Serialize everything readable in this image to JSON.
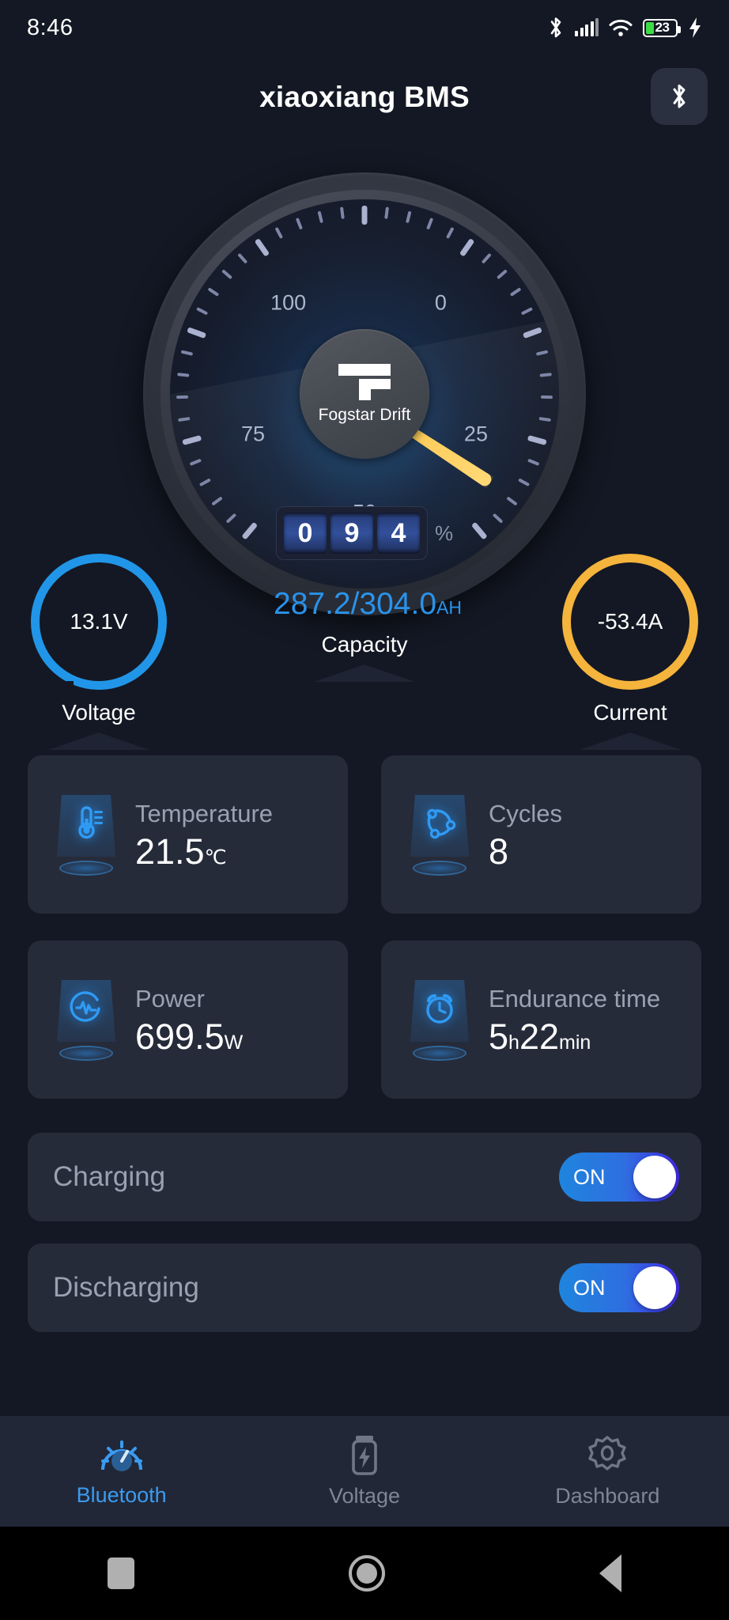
{
  "status_bar": {
    "time": "8:46",
    "bluetooth_icon": "bluetooth-icon",
    "signal_icon": "signal-bars-icon",
    "wifi_icon": "wifi-icon",
    "battery_percent": "23",
    "charging_icon": "lightning-bolt-icon"
  },
  "app_bar": {
    "title": "xiaoxiang BMS",
    "bluetooth_button_icon": "bluetooth-icon"
  },
  "gauge": {
    "brand": "Fogstar Drift",
    "scale_labels": [
      "0",
      "25",
      "50",
      "75",
      "100"
    ],
    "value_digits": [
      "0",
      "9",
      "4"
    ],
    "unit": "%",
    "value": 94,
    "needle_color": "#ffd060"
  },
  "metrics": {
    "voltage": {
      "value": "13.1V",
      "label": "Voltage",
      "ring_color": "#2196e8"
    },
    "capacity": {
      "value": "287.2/304.0",
      "unit": "AH",
      "label": "Capacity",
      "color": "#2a93ea"
    },
    "current": {
      "value": "-53.4A",
      "label": "Current",
      "ring_color": "#f5b43c"
    }
  },
  "cards": [
    {
      "icon": "thermometer-icon",
      "title": "Temperature",
      "value": "21.5",
      "unit": "℃"
    },
    {
      "icon": "cycles-icon",
      "title": "Cycles",
      "value": "8",
      "unit": ""
    },
    {
      "icon": "power-pulse-icon",
      "title": "Power",
      "value": "699.5",
      "unit": "W"
    },
    {
      "icon": "alarm-clock-icon",
      "title": "Endurance time",
      "value": "5",
      "unit": "h",
      "value2": "22",
      "unit2": "min"
    }
  ],
  "toggles": [
    {
      "label": "Charging",
      "state": "ON"
    },
    {
      "label": "Discharging",
      "state": "ON"
    }
  ],
  "bottom_nav": [
    {
      "label": "Bluetooth",
      "icon": "gauge-icon",
      "active": true
    },
    {
      "label": "Voltage",
      "icon": "battery-bolt-icon",
      "active": false
    },
    {
      "label": "Dashboard",
      "icon": "gear-icon",
      "active": false
    }
  ],
  "android_nav": [
    "recents-button",
    "home-button",
    "back-button"
  ]
}
